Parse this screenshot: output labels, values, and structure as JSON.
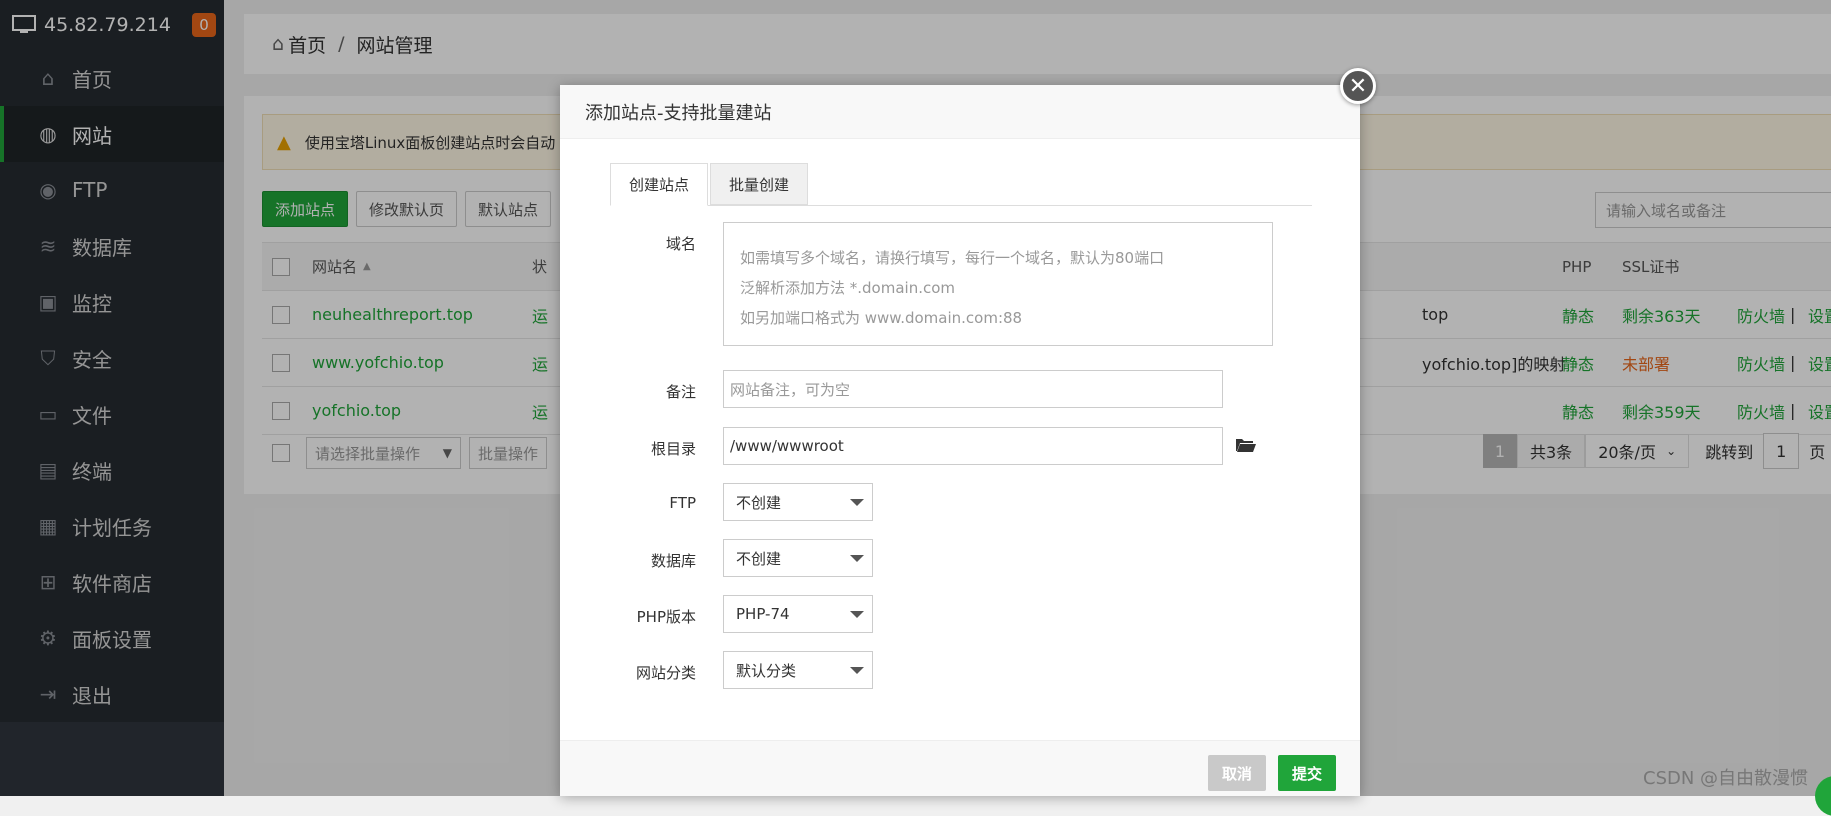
{
  "sidebar": {
    "host_ip": "45.82.79.214",
    "badge_count": "0",
    "items": [
      {
        "label": "首页",
        "icon": "home-icon"
      },
      {
        "label": "网站",
        "icon": "globe-icon"
      },
      {
        "label": "FTP",
        "icon": "ftp-icon"
      },
      {
        "label": "数据库",
        "icon": "database-icon"
      },
      {
        "label": "监控",
        "icon": "monitor-icon"
      },
      {
        "label": "安全",
        "icon": "shield-icon"
      },
      {
        "label": "文件",
        "icon": "folder-icon"
      },
      {
        "label": "终端",
        "icon": "terminal-icon"
      },
      {
        "label": "计划任务",
        "icon": "calendar-icon"
      },
      {
        "label": "软件商店",
        "icon": "apps-icon"
      },
      {
        "label": "面板设置",
        "icon": "gear-icon"
      },
      {
        "label": "退出",
        "icon": "logout-icon"
      }
    ]
  },
  "breadcrumb": {
    "home": "首页",
    "separator": "/",
    "current": "网站管理"
  },
  "notice": {
    "text": "使用宝塔Linux面板创建站点时会自动"
  },
  "toolbar": {
    "add_site": "添加站点",
    "modify_default": "修改默认页",
    "default_site": "默认站点"
  },
  "search": {
    "placeholder": "请输入域名或备注"
  },
  "table": {
    "headers": {
      "name": "网站名",
      "status": "状",
      "php": "PHP",
      "ssl": "SSL证书"
    },
    "rows": [
      {
        "name": "neuhealthreport.top",
        "status": "运",
        "remark": "top",
        "php": "静态",
        "ssl": "剩余363天",
        "firewall": "防火墙",
        "sep": "|",
        "settings": "设置"
      },
      {
        "name": "www.yofchio.top",
        "status": "运",
        "remark": "yofchio.top]的映射",
        "php": "静态",
        "ssl": "未部署",
        "firewall": "防火墙",
        "sep": "|",
        "settings": "设置"
      },
      {
        "name": "yofchio.top",
        "status": "运",
        "remark": "",
        "php": "静态",
        "ssl": "剩余359天",
        "firewall": "防火墙",
        "sep": "|",
        "settings": "设置"
      }
    ]
  },
  "pager": {
    "batch_placeholder": "请选择批量操作",
    "batch_button": "批量操作",
    "current_page": "1",
    "total": "共3条",
    "per_page": "20条/页",
    "jump_label": "跳转到",
    "jump_value": "1",
    "page_suffix": "页"
  },
  "modal": {
    "title": "添加站点-支持批量建站",
    "tabs": [
      "创建站点",
      "批量创建"
    ],
    "domain": {
      "label": "域名",
      "placeholder_lines": [
        "如需填写多个域名，请换行填写，每行一个域名，默认为80端口",
        "泛解析添加方法 *.domain.com",
        "如另加端口格式为 www.domain.com:88"
      ]
    },
    "remark": {
      "label": "备注",
      "placeholder": "网站备注，可为空"
    },
    "root": {
      "label": "根目录",
      "value": "/www/wwwroot"
    },
    "ftp": {
      "label": "FTP",
      "value": "不创建"
    },
    "database": {
      "label": "数据库",
      "value": "不创建"
    },
    "php": {
      "label": "PHP版本",
      "value": "PHP-74"
    },
    "category": {
      "label": "网站分类",
      "value": "默认分类"
    },
    "cancel": "取消",
    "submit": "提交"
  },
  "watermark": "CSDN @自由散漫惯"
}
